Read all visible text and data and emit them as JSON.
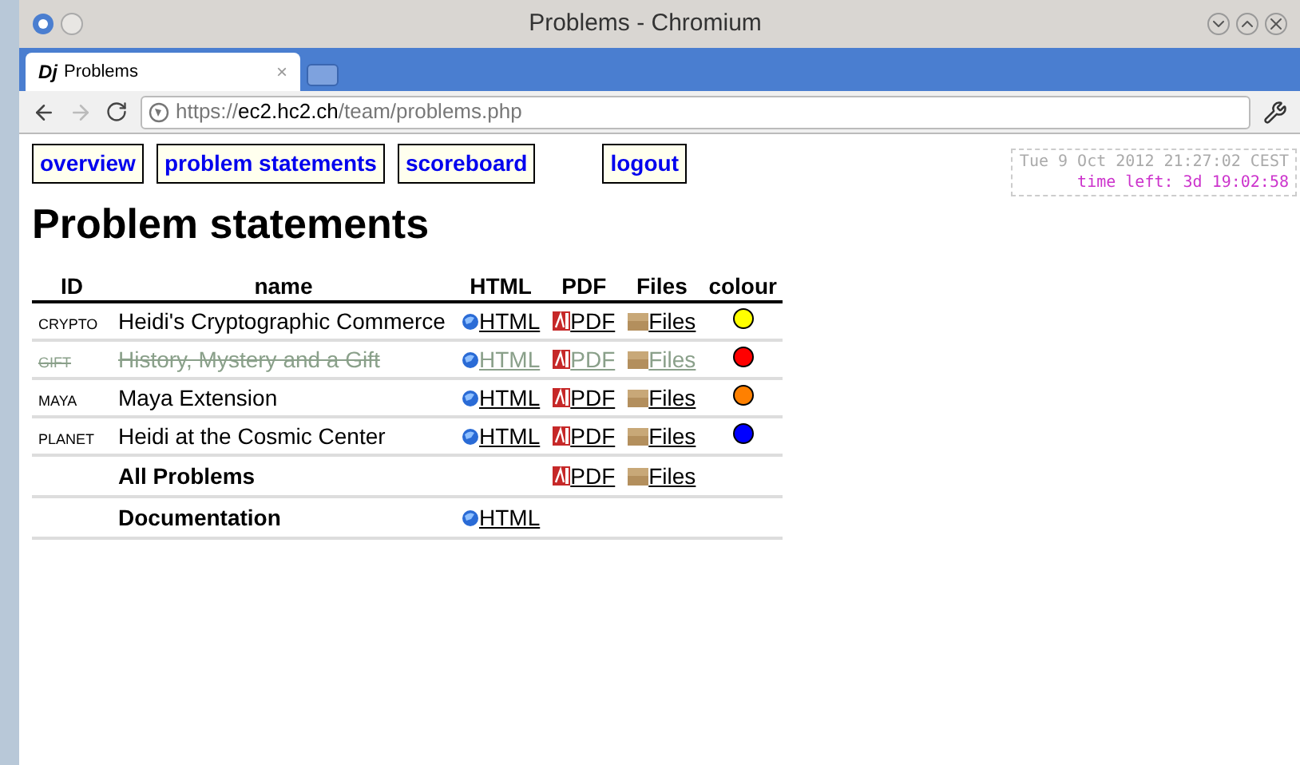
{
  "window": {
    "title": "Problems - Chromium"
  },
  "tabs": [
    {
      "favicon": "Dj",
      "label": "Problems",
      "close": "×",
      "selected": true
    }
  ],
  "address_bar": {
    "scheme": "https://",
    "host": "ec2.hc2.ch",
    "path": "/team/problems.php"
  },
  "nav": [
    {
      "label": "overview"
    },
    {
      "label": "problem statements"
    },
    {
      "label": "scoreboard"
    },
    {
      "label": "logout",
      "spaced": true
    }
  ],
  "clock": {
    "date": "Tue 9 Oct 2012 21:27:02 CEST",
    "time_left": "time left: 3d 19:02:58"
  },
  "heading": "Problem statements",
  "table": {
    "columns": [
      "ID",
      "name",
      "HTML",
      "PDF",
      "Files",
      "colour"
    ],
    "rows": [
      {
        "kind": "problem",
        "id": "CRYPTO",
        "name": "Heidi's Cryptographic Commerce",
        "html": "HTML",
        "pdf": "PDF",
        "files": "Files",
        "color": "#ffff00",
        "disabled": false
      },
      {
        "kind": "problem",
        "id": "GIFT",
        "name": "History, Mystery and a Gift",
        "html": "HTML",
        "pdf": "PDF",
        "files": "Files",
        "color": "#ff0000",
        "disabled": true
      },
      {
        "kind": "problem",
        "id": "MAYA",
        "name": "Maya Extension",
        "html": "HTML",
        "pdf": "PDF",
        "files": "Files",
        "color": "#ff8000",
        "disabled": false
      },
      {
        "kind": "problem",
        "id": "PLANET",
        "name": "Heidi at the Cosmic Center",
        "html": "HTML",
        "pdf": "PDF",
        "files": "Files",
        "color": "#0000ff",
        "disabled": false
      },
      {
        "kind": "summary",
        "name": "All Problems",
        "pdf": "PDF",
        "files": "Files"
      },
      {
        "kind": "summary",
        "name": "Documentation",
        "html": "HTML"
      }
    ]
  }
}
